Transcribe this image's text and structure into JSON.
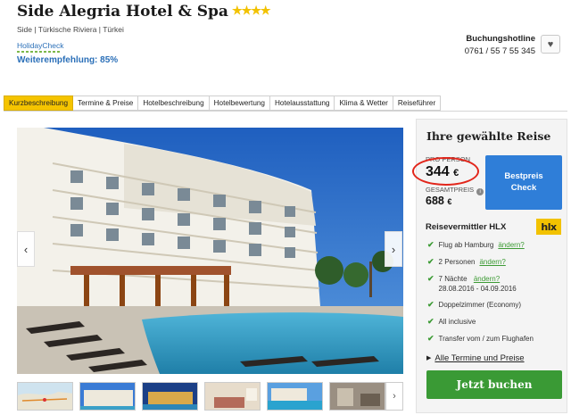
{
  "hotel": {
    "name": "Side Alegria Hotel & Spa",
    "stars": "★★★★",
    "location": "Side | Türkische Riviera | Türkei",
    "holidaycheck_logo": "HolidayCheck",
    "recommendation": "Weiterempfehlung:  85%"
  },
  "hotline": {
    "label": "Buchungshotline",
    "number": "0761 / 55 7 55 345"
  },
  "tabs": [
    {
      "label": "Kurzbeschreibung",
      "active": true
    },
    {
      "label": "Termine & Preise"
    },
    {
      "label": "Hotelbeschreibung"
    },
    {
      "label": "Hotelbewertung"
    },
    {
      "label": "Hotelausstattung"
    },
    {
      "label": "Klima & Wetter"
    },
    {
      "label": "Reiseführer"
    }
  ],
  "gallery": {
    "prev_icon": "‹",
    "next_icon": "›",
    "thumbs_next_icon": "›"
  },
  "trip": {
    "title": "Ihre gewählte Reise",
    "per_person_label": "PRO PERSON",
    "per_person_price": "344",
    "currency": "€",
    "total_label": "GESAMTPREIS",
    "info_icon": "i",
    "total_price": "688",
    "check_button": "Bestpreis\nCheck",
    "vendor_label": "Reisevermittler HLX",
    "vendor_logo": "hlx",
    "features": [
      {
        "text": "Flug ab Hamburg",
        "link": "ändern?"
      },
      {
        "text": "2 Personen",
        "link": "ändern?"
      },
      {
        "text": "7 Nächte",
        "link": "ändern?",
        "sub": "28.08.2016 - 04.09.2016"
      },
      {
        "text": "Doppelzimmer (Economy)"
      },
      {
        "text": "All inclusive"
      },
      {
        "text": "Transfer vom / zum Flughafen"
      }
    ],
    "all_dates": "Alle Termine und Preise",
    "book_button": "Jetzt buchen"
  },
  "colors": {
    "tab_active": "#f5c400",
    "link_blue": "#2a6fb8",
    "check_button": "#2f7ed8",
    "book_button": "#3a9a35",
    "highlight_oval": "#e2261b"
  }
}
